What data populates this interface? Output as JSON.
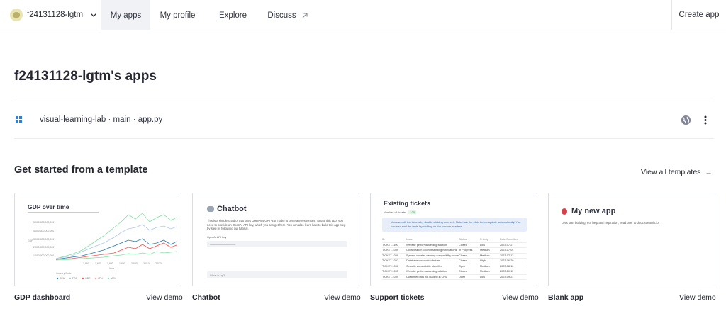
{
  "nav": {
    "workspace": "f24131128-lgtm",
    "items": [
      "My apps",
      "My profile",
      "Explore",
      "Discuss"
    ],
    "create": "Create app"
  },
  "page": {
    "title": "f24131128-lgtm's apps"
  },
  "app": {
    "path": "visual-learning-lab · main · app.py"
  },
  "templates": {
    "heading": "Get started from a template",
    "view_all": "View all templates",
    "cards": [
      {
        "label": "GDP dashboard",
        "demo": "View demo",
        "preview_title": "GDP over time",
        "legend_title": "Country Code",
        "legend": [
          "DEU",
          "FRA",
          "GBR",
          "JPN",
          "MEX"
        ],
        "x_label": "Year",
        "y_label": "GDP",
        "y_ticks": [
          "5,000,000,000,000",
          "4,000,000,000,000",
          "3,000,000,000,000",
          "2,000,000,000,000",
          "1,000,000,000,000"
        ],
        "x_ticks": [
          "1,960",
          "1,970",
          "1,980",
          "1,990",
          "2,000",
          "2,010",
          "2,020"
        ]
      },
      {
        "label": "Chatbot",
        "demo": "View demo",
        "preview_title": "Chatbot",
        "text": "This is a simple chatbot that uses OpenAI's GPT-3.5 model to generate responses. To use this app, you need to provide an OpenAI API key, which you can get here. You can also learn how to build this app step by step by following our tutorial.",
        "key_label": "OpenAI API Key",
        "key_value": "••••••••••••••••••••••••••••••••••••••••",
        "ask": "What is up?"
      },
      {
        "label": "Support tickets",
        "demo": "View demo",
        "preview_title": "Existing tickets",
        "count_label": "Number of tickets:",
        "count": "100",
        "info": "You can edit the tickets by double clicking on a cell. Note how the plots below update automatically! You can also sort the table by clicking on the column headers.",
        "columns": [
          "ID",
          "Issue",
          "Status",
          "Priority",
          "Date Submitted"
        ],
        "rows": [
          [
            "TICKET-1100",
            "Website performance degradation",
            "Closed",
            "Low",
            "2023-07-27"
          ],
          [
            "TICKET-1099",
            "Collaboration tool not sending notifications",
            "In Progress",
            "Medium",
            "2023-07-04"
          ],
          [
            "TICKET-1098",
            "System updates causing compatibility issues",
            "Closed",
            "Medium",
            "2023-07-12"
          ],
          [
            "TICKET-1097",
            "Database connection failure",
            "Closed",
            "High",
            "2023-06-20"
          ],
          [
            "TICKET-1096",
            "Security vulnerability identified",
            "Open",
            "Medium",
            "2023-08-10"
          ],
          [
            "TICKET-1095",
            "Website performance degradation",
            "Closed",
            "Medium",
            "2023-10-11"
          ],
          [
            "TICKET-1094",
            "Customer data not loading in CRM",
            "Open",
            "Low",
            "2023-09-21"
          ]
        ]
      },
      {
        "label": "Blank app",
        "demo": "View demo",
        "preview_title": "My new app",
        "text": "Let's start building! For help and inspiration, head over to docs.streamlit.io."
      }
    ]
  },
  "colors": {
    "nav_active_bg": "#f0f2f6",
    "border": "#e6e6ea",
    "link_blue": "#2d7fd8",
    "gdp_lines": [
      "#1f77b4",
      "#aec7e8",
      "#ff4b4b",
      "#7ee0a0",
      "#9ad0f5"
    ]
  },
  "icons": [
    "workspace-avatar-icon",
    "chevron-down-icon",
    "external-arrow-icon",
    "app-grid-icon",
    "globe-icon",
    "kebab-menu-icon",
    "arrow-right-icon",
    "chat-bubble-icon",
    "balloon-icon"
  ]
}
